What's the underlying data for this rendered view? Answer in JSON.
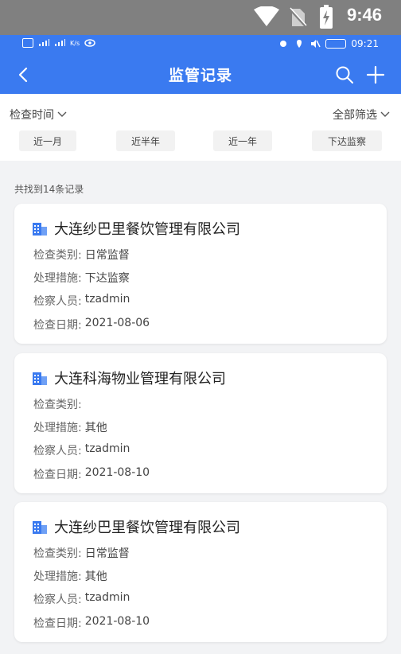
{
  "system_status": {
    "time": "9:46"
  },
  "app_status": {
    "time": "09:21",
    "speed_unit": "K/s"
  },
  "header": {
    "title": "监管记录"
  },
  "filters": {
    "check_time": "检查时间",
    "all_filter": "全部筛选",
    "chips": [
      "近一月",
      "近半年",
      "近一年",
      "下达监察"
    ]
  },
  "result_summary": "共找到14条记录",
  "labels": {
    "category": "检查类别:",
    "measure": "处理措施:",
    "inspector": "检察人员:",
    "date": "检查日期:"
  },
  "records": [
    {
      "company": "大连纱巴里餐饮管理有限公司",
      "category": "日常监督",
      "measure": "下达监察",
      "inspector": "tzadmin",
      "date": "2021-08-06"
    },
    {
      "company": "大连科海物业管理有限公司",
      "category": "",
      "measure": "其他",
      "inspector": "tzadmin",
      "date": "2021-08-10"
    },
    {
      "company": "大连纱巴里餐饮管理有限公司",
      "category": "日常监督",
      "measure": "其他",
      "inspector": "tzadmin",
      "date": "2021-08-10"
    }
  ],
  "colors": {
    "primary": "#3a7af0",
    "system_bar": "#808080",
    "background": "#f2f3f5"
  }
}
